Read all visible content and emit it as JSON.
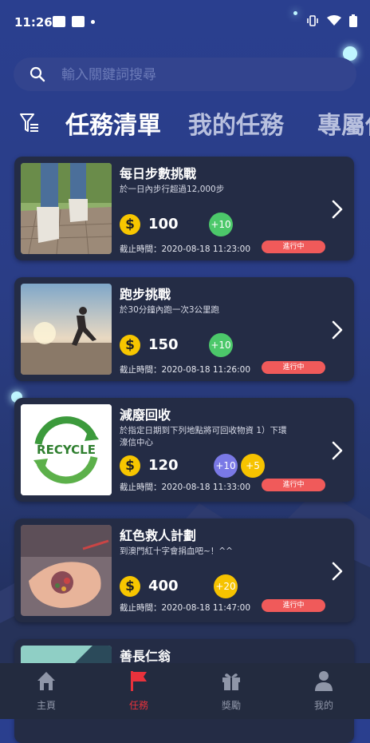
{
  "status_bar": {
    "time": "11:26"
  },
  "search": {
    "placeholder": "輸入關鍵詞搜尋"
  },
  "tabs": [
    {
      "label": "任務清單",
      "active": true
    },
    {
      "label": "我的任務",
      "active": false
    },
    {
      "label": "專屬任",
      "active": false
    }
  ],
  "tasks": [
    {
      "title": "每日步數挑戰",
      "description": "於一日內步行超過12,000步",
      "coin_symbol": "$",
      "points": "100",
      "badges": [
        {
          "label": "+10",
          "color": "green"
        }
      ],
      "deadline": "截止時間：2020-08-18 11:23:00",
      "status": "進行中"
    },
    {
      "title": "跑步挑戰",
      "description": "於30分鐘內跑一次3公里跑",
      "coin_symbol": "$",
      "points": "150",
      "badges": [
        {
          "label": "+10",
          "color": "green"
        }
      ],
      "deadline": "截止時間：2020-08-18 11:26:00",
      "status": "進行中"
    },
    {
      "title": "減廢回收",
      "description": "於指定日期到下列地點將可回收物資 1）下環濠信中心",
      "thumb_text": "RECYCLE",
      "coin_symbol": "$",
      "points": "120",
      "badges": [
        {
          "label": "+10",
          "color": "purple"
        },
        {
          "label": "+5",
          "color": "yellow"
        }
      ],
      "deadline": "截止時間：2020-08-18 11:33:00",
      "status": "進行中"
    },
    {
      "title": "紅色救人計劃",
      "description": "到澳門紅十字會捐血吧~！^^",
      "coin_symbol": "$",
      "points": "400",
      "badges": [
        {
          "label": "+20",
          "color": "yellow"
        }
      ],
      "deadline": "截止時間：2020-08-18 11:47:00",
      "status": "進行中"
    },
    {
      "title": "善長仁翁"
    }
  ],
  "bottom_nav": [
    {
      "label": "主頁",
      "icon": "home-icon",
      "active": false
    },
    {
      "label": "任務",
      "icon": "flag-icon",
      "active": true
    },
    {
      "label": "獎勵",
      "icon": "gift-icon",
      "active": false
    },
    {
      "label": "我的",
      "icon": "person-icon",
      "active": false
    }
  ],
  "colors": {
    "background": "#2a3f8f",
    "card": "#242c45",
    "accent_red": "#e8323c",
    "coin": "#f7c600",
    "status_pill": "#f05a5a",
    "inactive_nav": "#8f96a8"
  }
}
